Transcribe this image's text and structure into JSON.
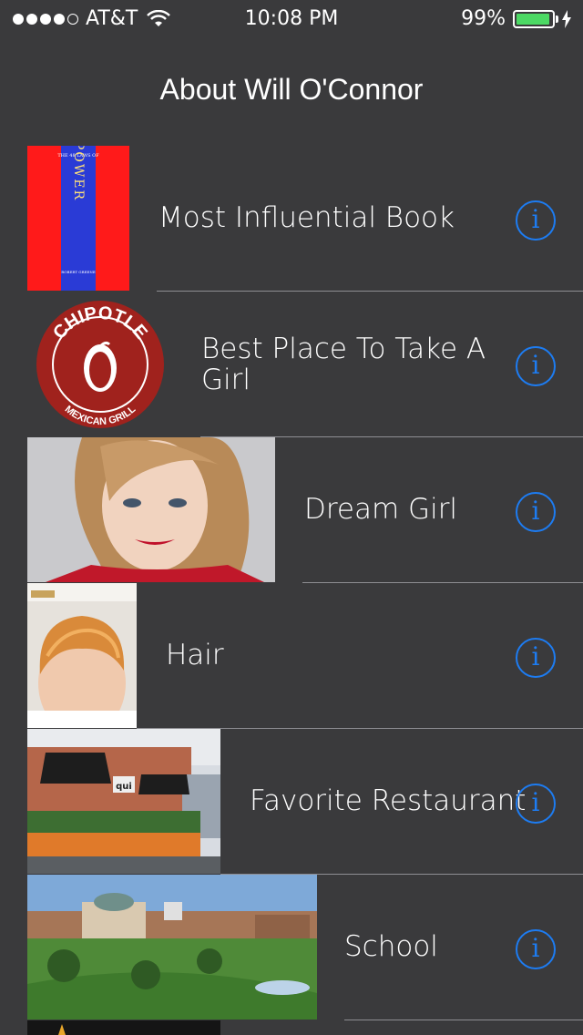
{
  "status_bar": {
    "carrier": "AT&T",
    "time": "10:08 PM",
    "battery_percent": "99%",
    "battery_level": 0.99,
    "signal_bars": 4,
    "signal_max": 5
  },
  "nav": {
    "title": "About Will O'Connor"
  },
  "colors": {
    "background": "#3a3a3c",
    "accent": "#1d7cf2",
    "battery": "#4cd964"
  },
  "rows": [
    {
      "label": "Most Influential Book",
      "thumb": "book cover",
      "cover_small": "THE 48 LAWS OF",
      "cover_title": "POWER",
      "cover_author": "ROBERT GREENE"
    },
    {
      "label": "Best Place To Take A Girl",
      "thumb": "chipotle logo",
      "logo_top": "CHIPOTLE",
      "logo_bottom": "MEXICAN GRILL"
    },
    {
      "label": "Dream Girl",
      "thumb": "portrait photo"
    },
    {
      "label": "Hair",
      "thumb": "hair photo"
    },
    {
      "label": "Favorite Restaurant",
      "thumb": "restaurant photo",
      "sign": "qui"
    },
    {
      "label": "School",
      "thumb": "campus photo"
    }
  ],
  "info_icon": "info-icon"
}
